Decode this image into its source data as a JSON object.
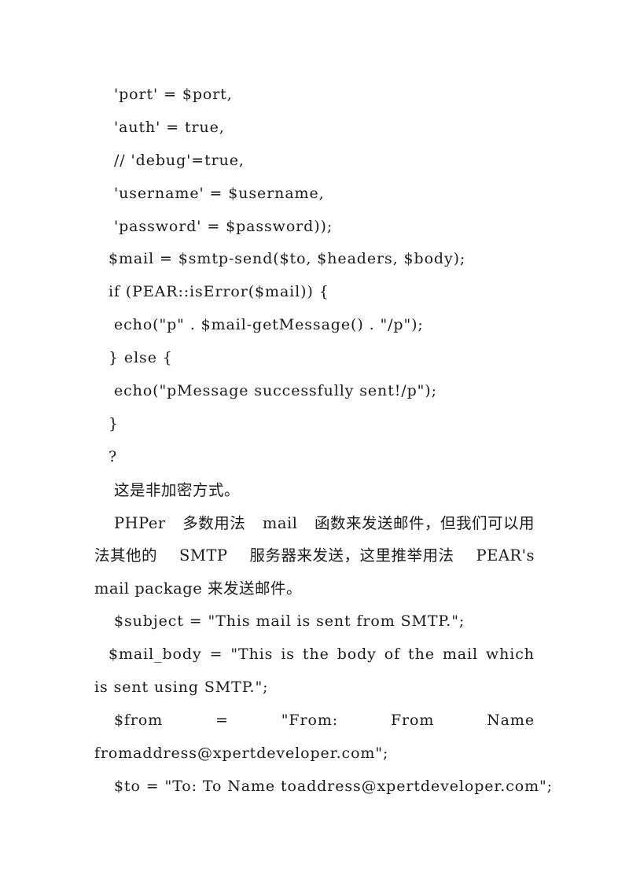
{
  "document": {
    "page_background": "#ffffff",
    "text_color": "#1b1b1b",
    "lines": [
      {
        "id": "l1",
        "text": "'port' = $port,",
        "kind": "code",
        "indent": 2
      },
      {
        "id": "l2",
        "text": "'auth' = true,",
        "kind": "code",
        "indent": 2
      },
      {
        "id": "l3",
        "text": "// 'debug'=true,",
        "kind": "code",
        "indent": 2
      },
      {
        "id": "l4",
        "text": "'username' = $username,",
        "kind": "code",
        "indent": 2
      },
      {
        "id": "l5",
        "text": "'password' = $password));",
        "kind": "code",
        "indent": 2
      },
      {
        "id": "l6",
        "text": "$mail = $smtp-send($to, $headers, $body);",
        "kind": "code",
        "indent": 1
      },
      {
        "id": "l7",
        "text": "if (PEAR::isError($mail)) {",
        "kind": "code",
        "indent": 1
      },
      {
        "id": "l8",
        "text": "echo(\"p\" . $mail-getMessage() . \"/p\");",
        "kind": "code",
        "indent": 2
      },
      {
        "id": "l9",
        "text": "} else {",
        "kind": "code",
        "indent": 1
      },
      {
        "id": "l10",
        "text": "echo(\"pMessage successfully sent!/p\");",
        "kind": "code",
        "indent": 2
      },
      {
        "id": "l11",
        "text": "}",
        "kind": "code",
        "indent": 1
      },
      {
        "id": "l12",
        "text": "?",
        "kind": "code",
        "indent": 1
      },
      {
        "id": "l13",
        "text": "这是非加密方式。",
        "kind": "cjk",
        "indent": 2
      }
    ],
    "paragraph_php": {
      "line1_segments": [
        "PHPer",
        "多数用法",
        "mail",
        "函数来发送邮件，但我们可以用"
      ],
      "line2_segments": [
        "法其他的",
        "SMTP",
        "服务器来发送，这里推举用法",
        "PEAR's"
      ],
      "line3_text": "mail package 来发送邮件。"
    },
    "code_tail": {
      "subject_line": "$subject = \"This mail is sent from SMTP.\";",
      "mail_body_line1_segments": [
        "$mail_body",
        "=",
        "\"This",
        "is",
        "the",
        "body",
        "of",
        "the",
        "mail",
        "which"
      ],
      "mail_body_line2": "is sent using SMTP.\";",
      "from_line1_segments": [
        "$from",
        "=",
        "\"From:",
        "From",
        "Name"
      ],
      "from_line2": "fromaddress@xpertdeveloper.com\";",
      "to_line": "$to = \"To: To Name toaddress@xpertdeveloper.com\";"
    }
  }
}
